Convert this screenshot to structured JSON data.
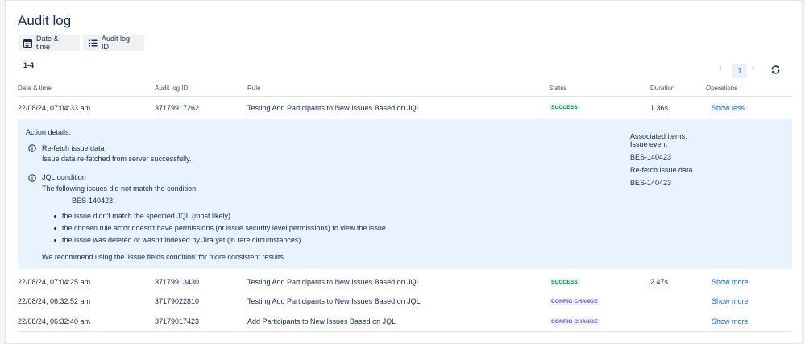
{
  "title": "Audit log",
  "filters": {
    "date_time": "Date & time",
    "audit_log_id": "Audit log ID"
  },
  "results_count": "1-4",
  "pagination": {
    "prev": "‹",
    "page": "1",
    "next": "›"
  },
  "columns": [
    "Date & time",
    "Audit log ID",
    "Rule",
    "Status",
    "Duration",
    "Operations"
  ],
  "rows": [
    {
      "date": "22/08/24, 07:04:33 am",
      "id": "37179917262",
      "rule": "Testing Add Participants to New Issues Based on JQL",
      "status": "SUCCESS",
      "duration": "1.36s",
      "operation": "Show less"
    },
    {
      "date": "22/08/24, 07:04:25 am",
      "id": "37179913430",
      "rule": "Testing Add Participants to New Issues Based on JQL",
      "status": "SUCCESS",
      "duration": "2.47s",
      "operation": "Show more"
    },
    {
      "date": "22/08/24, 06:32:52 am",
      "id": "37179022810",
      "rule": "Testing Add Participants to New Issues Based on JQL",
      "status": "CONFIG CHANGE",
      "duration": "",
      "operation": "Show more"
    },
    {
      "date": "22/08/24, 06:32:40 am",
      "id": "37179017423",
      "rule": "Add Participants to New Issues Based on JQL",
      "status": "CONFIG CHANGE",
      "duration": "",
      "operation": "Show more"
    }
  ],
  "details": {
    "heading": "Action details:",
    "actions": [
      {
        "title": "Re-fetch issue data",
        "text": "Issue data re-fetched from server successfully."
      },
      {
        "title": "JQL condition",
        "text": "The following issues did not match the condition:",
        "issue": "BES-140423"
      }
    ],
    "bullets": [
      "the issue didn't match the specified JQL (most likely)",
      "the chosen rule actor doesn't have permissions (or issue security level permissions) to view the issue",
      "the issue was deleted or wasn't indexed by Jira yet (in rare circumstances)"
    ],
    "recommendation": "We recommend using the 'Issue fields condition' for more consistent results.",
    "associated": {
      "heading": "Associated items:",
      "groups": [
        {
          "label": "Issue event",
          "link": "BES-140423"
        },
        {
          "label": "Re-fetch issue data",
          "link": "BES-140423"
        }
      ]
    }
  }
}
